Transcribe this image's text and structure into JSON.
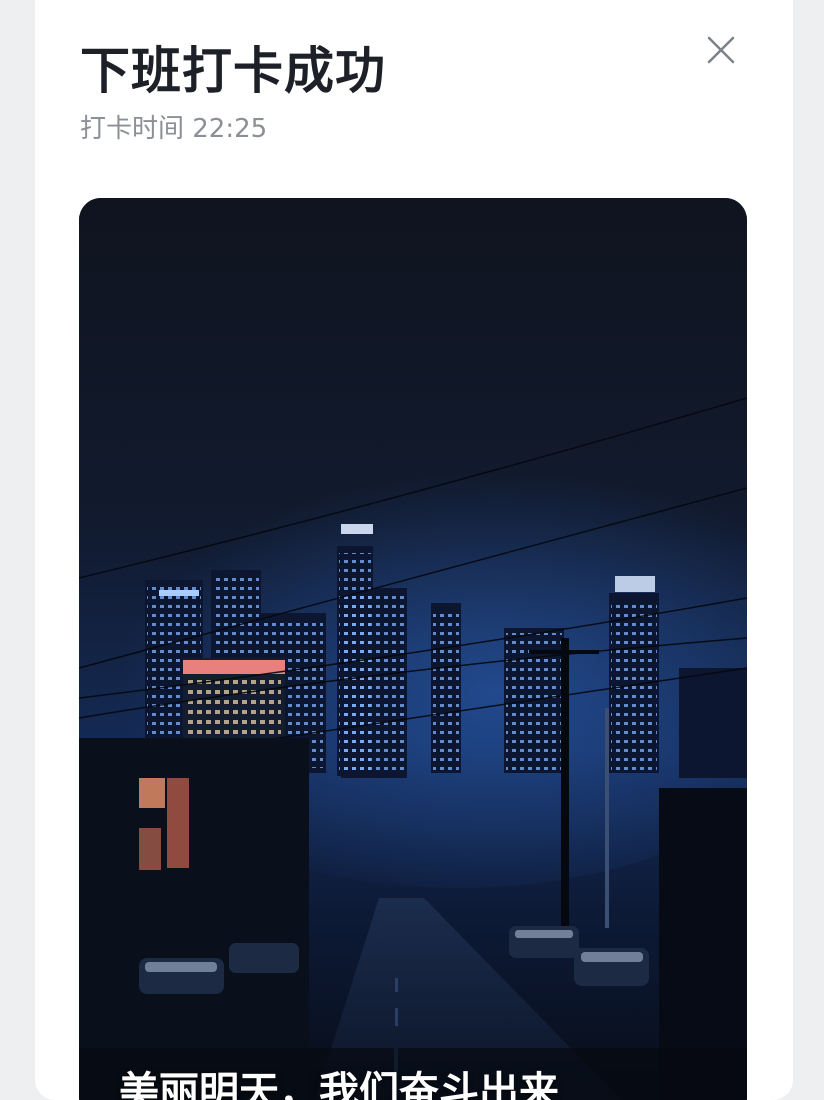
{
  "dialog": {
    "title": "下班打卡成功",
    "subtitle": "打卡时间 22:25",
    "caption": "美丽明天，我们奋斗出来"
  },
  "icons": {
    "close": "close-icon"
  },
  "colors": {
    "title": "#1d2127",
    "subtitle": "#8b8f96",
    "overlay_background": "#eeeff1",
    "card_background": "#ffffff",
    "night_sky": "#0e1422",
    "city_glow": "#3a7bd5"
  }
}
